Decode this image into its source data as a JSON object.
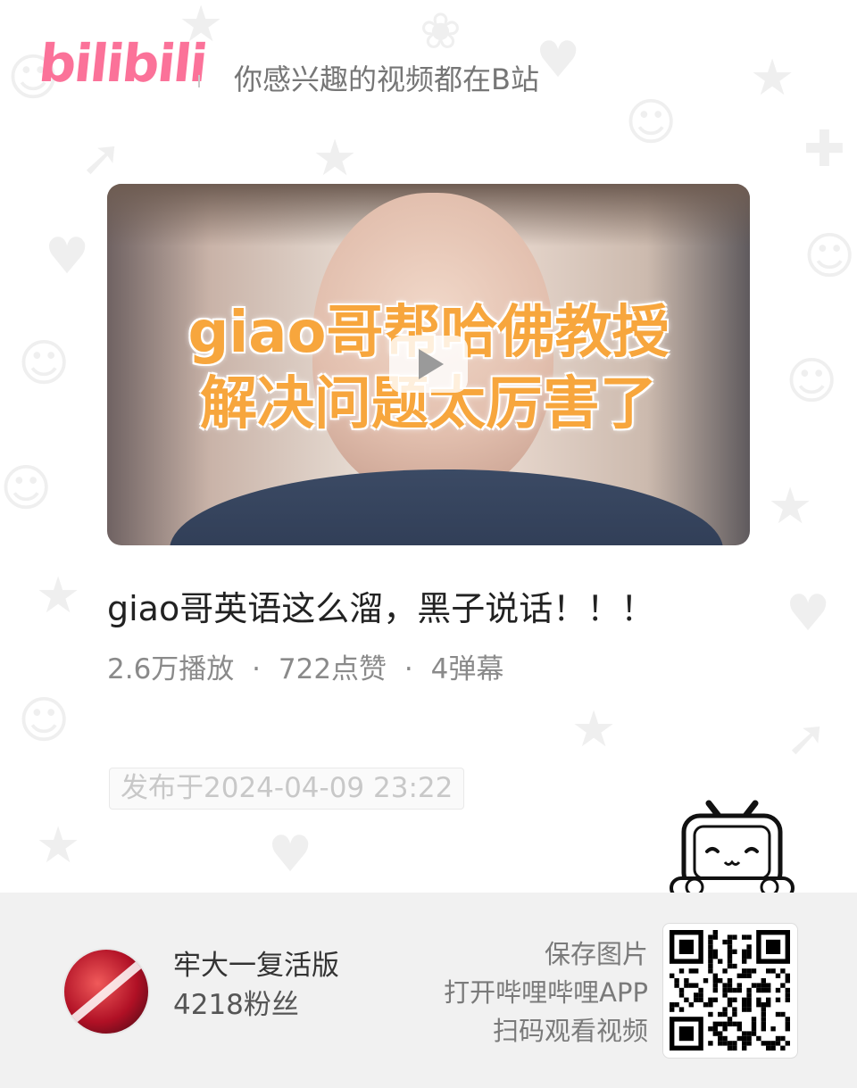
{
  "header": {
    "logo_text": "bilibili",
    "slogan": "你感兴趣的视频都在B站"
  },
  "video": {
    "thumbnail_caption_line1": "giao哥帮哈佛教授",
    "thumbnail_caption_line2": "解决问题太厉害了",
    "title": "giao哥英语这么溜，黑子说话！！！",
    "stats": {
      "plays": "2.6万播放",
      "likes": "722点赞",
      "danmaku": "4弹幕",
      "separator": "·"
    },
    "published": "发布于2024-04-09 23:22"
  },
  "footer": {
    "username": "牢大一复活版",
    "followers": "4218粉丝",
    "cta_lines": [
      "保存图片",
      "打开哔哩哔哩APP",
      "扫码观看视频"
    ]
  },
  "icons": {
    "play": "play-icon",
    "mascot": "bilibili-tv-mascot",
    "qr": "qr-code"
  },
  "colors": {
    "brand_pink": "#fb7299",
    "caption_orange": "#f7a63d"
  }
}
